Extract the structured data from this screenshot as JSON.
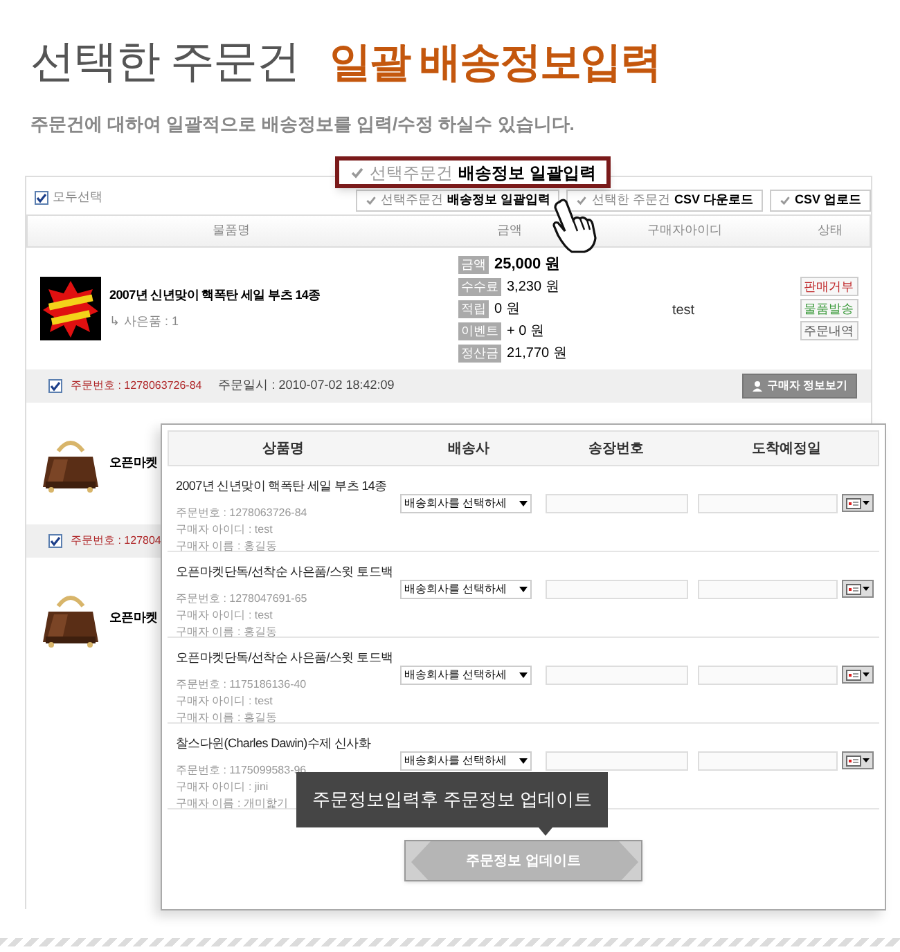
{
  "header": {
    "title": "선택한 주문건",
    "highlight": "일괄 배송정보입력",
    "subtitle": "주문건에 대하여 일괄적으로 배송정보를 입력/수정 하실수 있습니다."
  },
  "list": {
    "select_all": {
      "label": "모두선택",
      "checked": true
    },
    "toolbar": [
      {
        "prefix": "선택주문건",
        "label": "배송정보 일괄입력"
      },
      {
        "prefix": "선택한 주문건",
        "label": "CSV 다운로드"
      },
      {
        "label": "CSV 업로드"
      }
    ],
    "columns": [
      "물품명",
      "금액",
      "구매자아이디",
      "상태"
    ],
    "orders": [
      {
        "title": "2007년 신년맞이 핵폭탄 세일 부츠 14종",
        "gift": "↳ 사은품 : 1",
        "amounts": [
          {
            "label": "금액",
            "value": "25,000 원"
          },
          {
            "label": "수수료",
            "value": "3,230 원"
          },
          {
            "label": "적립",
            "value": "0 원"
          },
          {
            "label": "이벤트",
            "value": "+ 0 원"
          },
          {
            "label": "정산금",
            "value": "21,770 원"
          }
        ],
        "buyer": "test",
        "status_buttons": [
          {
            "label": "판매거부",
            "kind": "danger"
          },
          {
            "label": "물품발송",
            "kind": "success"
          },
          {
            "label": "주문내역",
            "kind": "default"
          }
        ],
        "checked": true,
        "order_no": "주문번호 : 1278063726-84",
        "order_date": "주문일시 : 2010-07-02 18:42:09",
        "buyer_button": "구매자 정보보기"
      },
      {
        "title": "오픈마켓",
        "checked": true,
        "order_no": "주문번호 : 127804"
      },
      {
        "title": "오픈마켓"
      }
    ]
  },
  "callout": {
    "prefix": "선택주문건",
    "label": "배송정보 일괄입력"
  },
  "panel": {
    "columns": [
      "상품명",
      "배송사",
      "송장번호",
      "도착예정일"
    ],
    "rows": [
      {
        "title": "2007년 신년맞이 핵폭탄 세일 부츠 14종",
        "meta": [
          "주문번호 : 1278063726-84",
          "구매자 아이디 : test",
          "구매자 이름 : 홍길동"
        ],
        "carrier": "배송회사를 선택하세"
      },
      {
        "title": "오픈마켓단독/선착순 사은품/스윗 토드백",
        "meta": [
          "주문번호 : 1278047691-65",
          "구매자 아이디 : test",
          "구매자 이름 : 홍길동"
        ],
        "carrier": "배송회사를 선택하세"
      },
      {
        "title": "오픈마켓단독/선착순 사은품/스윗 토드백",
        "meta": [
          "주문번호 : 1175186136-40",
          "구매자 아이디 : test",
          "구매자 이름 : 홍길동"
        ],
        "carrier": "배송회사를 선택하세"
      },
      {
        "title": "찰스다윈(Charles Dawin)수제 신사화",
        "meta": [
          "주문번호 : 1175099583-96",
          "구매자 아이디 : jini",
          "구매자 이름 : 개미핥기"
        ],
        "carrier": "배송회사를 선택하세"
      }
    ],
    "update_button": "주문정보 업데이트"
  },
  "tooltip": "주문정보입력후 주문정보 업데이트"
}
